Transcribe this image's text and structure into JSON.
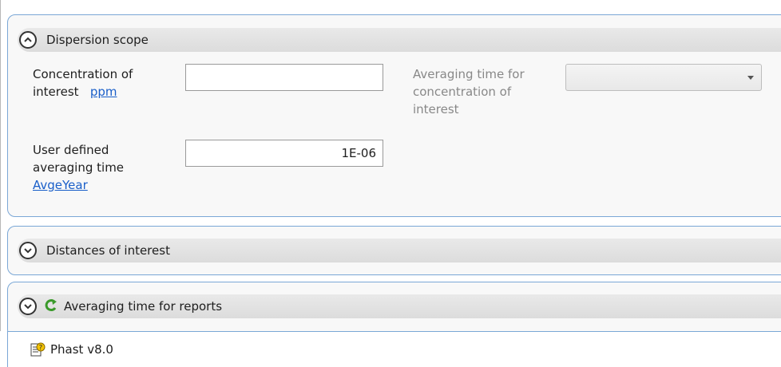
{
  "scope_section": {
    "title": "Dispersion scope",
    "concentration_label_1": "Concentration of",
    "concentration_label_2": "interest",
    "concentration_unit": "ppm",
    "concentration_value": "",
    "averaging_label_1": "Averaging time for",
    "averaging_label_2": "concentration of",
    "averaging_label_3": "interest",
    "averaging_selected": "",
    "user_avg_label_1": "User defined",
    "user_avg_label_2": "averaging time",
    "user_avg_unit": "AvgeYear",
    "user_avg_value": "1E-06"
  },
  "distances_section": {
    "title": "Distances of interest"
  },
  "reports_section": {
    "title": "Averaging time for reports",
    "icon": "refresh-icon"
  },
  "status_bar": {
    "app_name": "Phast v8.0",
    "icon": "help-document-icon"
  },
  "colors": {
    "border_accent": "#7aa7d6",
    "link": "#1a5fc9",
    "header_bg": "#e0e0e0"
  }
}
